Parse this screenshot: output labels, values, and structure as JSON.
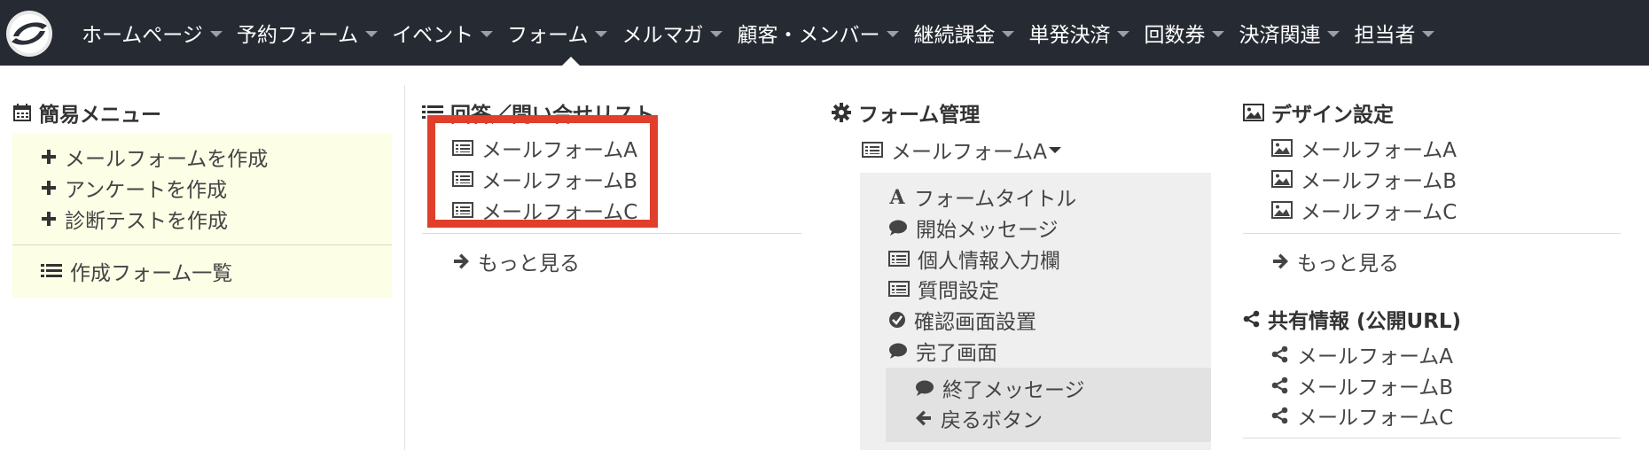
{
  "nav": {
    "items": [
      {
        "label": "ホームページ"
      },
      {
        "label": "予約フォーム"
      },
      {
        "label": "イベント"
      },
      {
        "label": "フォーム"
      },
      {
        "label": "メルマガ"
      },
      {
        "label": "顧客・メンバー"
      },
      {
        "label": "継続課金"
      },
      {
        "label": "単発決済"
      },
      {
        "label": "回数券"
      },
      {
        "label": "決済関連"
      },
      {
        "label": "担当者"
      }
    ],
    "active": "フォーム"
  },
  "simple_menu": {
    "title": "簡易メニュー",
    "items": [
      {
        "label": "メールフォームを作成",
        "icon": "plus-icon"
      },
      {
        "label": "アンケートを作成",
        "icon": "plus-icon"
      },
      {
        "label": "診断テストを作成",
        "icon": "plus-icon"
      },
      {
        "label": "作成フォーム一覧",
        "icon": "list-icon"
      }
    ]
  },
  "responses": {
    "title": "回答／問い合せリスト",
    "items": [
      {
        "label": "メールフォームA"
      },
      {
        "label": "メールフォームB"
      },
      {
        "label": "メールフォームC"
      }
    ],
    "more": "もっと見る",
    "highlight_color": "#e03f2c"
  },
  "form_manage": {
    "title": "フォーム管理",
    "selected": "メールフォームA",
    "items": [
      {
        "label": "フォームタイトル",
        "icon": "font-icon"
      },
      {
        "label": "開始メッセージ",
        "icon": "comment-icon"
      },
      {
        "label": "個人情報入力欄",
        "icon": "form-icon"
      },
      {
        "label": "質問設定",
        "icon": "form-icon"
      },
      {
        "label": "確認画面設置",
        "icon": "check-circle-icon"
      },
      {
        "label": "完了画面",
        "icon": "comment-icon"
      }
    ],
    "sub_items": [
      {
        "label": "終了メッセージ",
        "icon": "comment-icon"
      },
      {
        "label": "戻るボタン",
        "icon": "arrow-left-icon"
      }
    ]
  },
  "design": {
    "title": "デザイン設定",
    "items": [
      {
        "label": "メールフォームA"
      },
      {
        "label": "メールフォームB"
      },
      {
        "label": "メールフォームC"
      }
    ],
    "more": "もっと見る"
  },
  "share": {
    "title": "共有情報 (公開URL)",
    "items": [
      {
        "label": "メールフォームA"
      },
      {
        "label": "メールフォームB"
      },
      {
        "label": "メールフォームC"
      }
    ]
  }
}
